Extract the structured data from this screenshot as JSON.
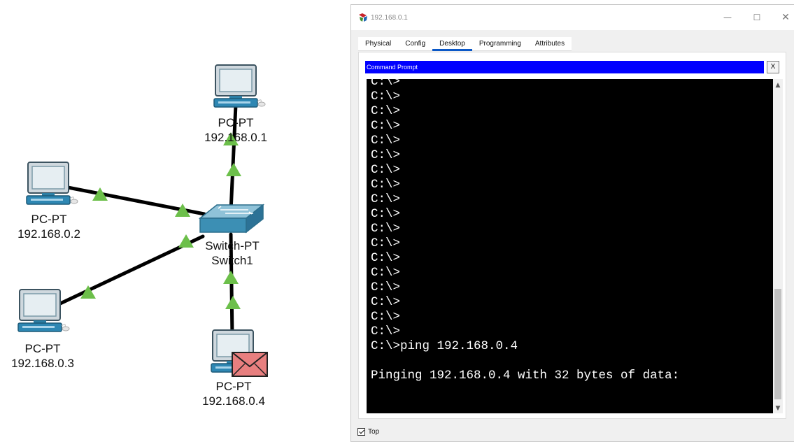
{
  "topology": {
    "nodes": [
      {
        "id": "pc1",
        "type": "PC-PT",
        "ip": "192.168.0.1"
      },
      {
        "id": "pc2",
        "type": "PC-PT",
        "ip": "192.168.0.2"
      },
      {
        "id": "pc3",
        "type": "PC-PT",
        "ip": "192.168.0.3"
      },
      {
        "id": "pc4",
        "type": "PC-PT",
        "ip": "192.168.0.4",
        "has_pdu": true
      },
      {
        "id": "switch1",
        "type": "Switch-PT",
        "name": "Switch1"
      }
    ],
    "link_status_color": "#6cbf4a",
    "pdu_color": "#e87f7f"
  },
  "window": {
    "title": "192.168.0.1",
    "controls": {
      "minimize": "—",
      "maximize": "☐",
      "close": "✕"
    },
    "tabs": [
      {
        "label": "Physical",
        "active": false
      },
      {
        "label": "Config",
        "active": false
      },
      {
        "label": "Desktop",
        "active": true
      },
      {
        "label": "Programming",
        "active": false
      },
      {
        "label": "Attributes",
        "active": false
      }
    ],
    "command_prompt": {
      "header": "Command Prompt",
      "close_label": "X",
      "lines": [
        "C:\\>",
        "C:\\>",
        "C:\\>",
        "C:\\>",
        "C:\\>",
        "C:\\>",
        "C:\\>",
        "C:\\>",
        "C:\\>",
        "C:\\>",
        "C:\\>",
        "C:\\>",
        "C:\\>",
        "C:\\>",
        "C:\\>",
        "C:\\>",
        "C:\\>",
        "C:\\>",
        "C:\\>ping 192.168.0.4",
        "",
        "Pinging 192.168.0.4 with 32 bytes of data:"
      ]
    },
    "top_checkbox": {
      "label": "Top",
      "checked": true
    },
    "header_color": "#0000ff",
    "active_tab_color": "#0b58c7"
  }
}
